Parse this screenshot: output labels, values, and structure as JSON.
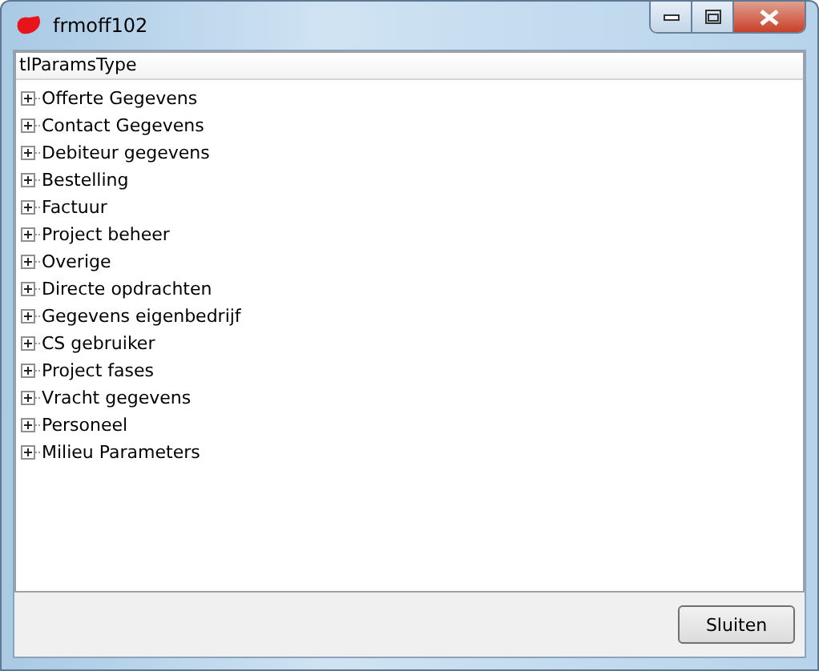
{
  "window": {
    "title": "frmoff102"
  },
  "tree": {
    "column": "tlParamsType",
    "items": [
      {
        "label": "Offerte Gegevens",
        "expanded": false
      },
      {
        "label": "Contact Gegevens",
        "expanded": false
      },
      {
        "label": "Debiteur gegevens",
        "expanded": false
      },
      {
        "label": "Bestelling",
        "expanded": false
      },
      {
        "label": "Factuur",
        "expanded": false
      },
      {
        "label": "Project beheer",
        "expanded": false
      },
      {
        "label": "Overige",
        "expanded": false
      },
      {
        "label": "Directe opdrachten",
        "expanded": false
      },
      {
        "label": "Gegevens eigenbedrijf",
        "expanded": false
      },
      {
        "label": "CS gebruiker",
        "expanded": false
      },
      {
        "label": "Project fases",
        "expanded": false
      },
      {
        "label": "Vracht gegevens",
        "expanded": false
      },
      {
        "label": "Personeel",
        "expanded": false
      },
      {
        "label": "Milieu Parameters",
        "expanded": false
      }
    ]
  },
  "buttons": [
    {
      "label": "Sluiten"
    }
  ]
}
